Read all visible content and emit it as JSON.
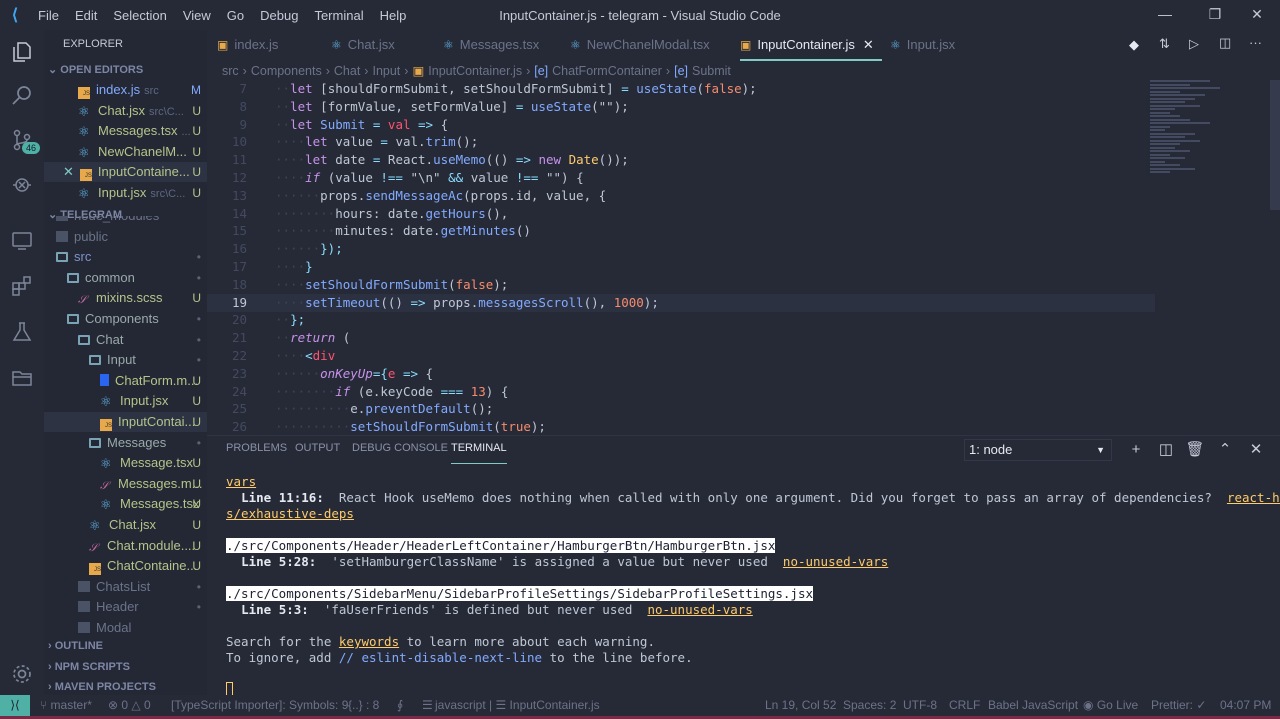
{
  "titlebar": {
    "menu": [
      "File",
      "Edit",
      "Selection",
      "View",
      "Go",
      "Debug",
      "Terminal",
      "Help"
    ],
    "title": "InputContainer.js - telegram - Visual Studio Code"
  },
  "activity": {
    "scm_badge": "46"
  },
  "sidebar": {
    "explorer_label": "EXPLORER",
    "open_editors_label": "OPEN EDITORS",
    "project_label": "TELEGRAM",
    "open_editors": [
      {
        "name": "index.js",
        "sub": "src",
        "status": "M",
        "icon": "js"
      },
      {
        "name": "Chat.jsx",
        "sub": "src\\C...",
        "status": "U",
        "icon": "react"
      },
      {
        "name": "Messages.tsx",
        "sub": "...",
        "status": "U",
        "icon": "react"
      },
      {
        "name": "NewChanelM...",
        "sub": "",
        "status": "U",
        "icon": "react"
      },
      {
        "name": "InputContaine...",
        "sub": "",
        "status": "U",
        "icon": "js",
        "active": true
      },
      {
        "name": "Input.jsx",
        "sub": "src\\C...",
        "status": "U",
        "icon": "react"
      }
    ],
    "tree": [
      {
        "name": "node_modules",
        "level": 0,
        "icon": "folderc",
        "status": ""
      },
      {
        "name": "public",
        "level": 0,
        "icon": "folderc",
        "status": ""
      },
      {
        "name": "src",
        "level": 0,
        "icon": "folder",
        "status": "•"
      },
      {
        "name": "common",
        "level": 1,
        "icon": "folder",
        "status": "•"
      },
      {
        "name": "mixins.scss",
        "level": 2,
        "icon": "sass",
        "status": "U"
      },
      {
        "name": "Components",
        "level": 1,
        "icon": "folder",
        "status": "•"
      },
      {
        "name": "Chat",
        "level": 2,
        "icon": "folder",
        "status": "•"
      },
      {
        "name": "Input",
        "level": 3,
        "icon": "folder",
        "status": "•"
      },
      {
        "name": "ChatForm.m...",
        "level": 4,
        "icon": "css",
        "status": "U"
      },
      {
        "name": "Input.jsx",
        "level": 4,
        "icon": "react",
        "status": "U"
      },
      {
        "name": "InputContai...",
        "level": 4,
        "icon": "js",
        "status": "U",
        "selected": true
      },
      {
        "name": "Messages",
        "level": 3,
        "icon": "folder",
        "status": "•"
      },
      {
        "name": "Message.tsx",
        "level": 4,
        "icon": "react",
        "status": "U"
      },
      {
        "name": "Messages.m...",
        "level": 4,
        "icon": "sass",
        "status": "U"
      },
      {
        "name": "Messages.tsx",
        "level": 4,
        "icon": "react",
        "status": "U"
      },
      {
        "name": "Chat.jsx",
        "level": 3,
        "icon": "react",
        "status": "U"
      },
      {
        "name": "Chat.module....",
        "level": 3,
        "icon": "sass",
        "status": "U"
      },
      {
        "name": "ChatContaine...",
        "level": 3,
        "icon": "js",
        "status": "U"
      },
      {
        "name": "ChatsList",
        "level": 2,
        "icon": "folderc",
        "status": "•"
      },
      {
        "name": "Header",
        "level": 2,
        "icon": "folderc",
        "status": "•"
      },
      {
        "name": "Modal",
        "level": 2,
        "icon": "folderc",
        "status": ""
      }
    ],
    "bottom_sections": [
      "OUTLINE",
      "NPM SCRIPTS",
      "MAVEN PROJECTS"
    ]
  },
  "tabs": [
    {
      "label": "index.js",
      "icon": "js"
    },
    {
      "label": "Chat.jsx",
      "icon": "react"
    },
    {
      "label": "Messages.tsx",
      "icon": "react"
    },
    {
      "label": "NewChanelModal.tsx",
      "icon": "react"
    },
    {
      "label": "InputContainer.js",
      "icon": "js",
      "active": true
    },
    {
      "label": "Input.jsx",
      "icon": "react"
    }
  ],
  "breadcrumbs": [
    "src",
    "Components",
    "Chat",
    "Input",
    "InputContainer.js",
    "ChatFormContainer",
    "Submit"
  ],
  "editor": {
    "current_line": 19,
    "lines": [
      {
        "n": "7",
        "t": [
          [
            "g",
            "··"
          ],
          [
            "k",
            "let "
          ],
          [
            "t",
            "[shouldFormSubmit, setShouldFormSubmit] "
          ],
          [
            "o",
            "= "
          ],
          [
            "f",
            "useState"
          ],
          [
            "t",
            "("
          ],
          [
            "n",
            "false"
          ],
          [
            "t",
            ");"
          ]
        ]
      },
      {
        "n": "8",
        "t": [
          [
            "g",
            "··"
          ],
          [
            "k",
            "let "
          ],
          [
            "t",
            "[formValue, setFormValue] "
          ],
          [
            "o",
            "= "
          ],
          [
            "f",
            "useState"
          ],
          [
            "t",
            "(\"\");"
          ]
        ]
      },
      {
        "n": "9",
        "t": [
          [
            "g",
            "··"
          ],
          [
            "k",
            "let "
          ],
          [
            "f",
            "Submit "
          ],
          [
            "o",
            "= "
          ],
          [
            "r",
            "val "
          ],
          [
            "o",
            "=> "
          ],
          [
            "t",
            "{"
          ]
        ]
      },
      {
        "n": "10",
        "t": [
          [
            "g",
            "····"
          ],
          [
            "k",
            "let "
          ],
          [
            "t",
            "value "
          ],
          [
            "o",
            "= "
          ],
          [
            "t",
            "val."
          ],
          [
            "f",
            "trim"
          ],
          [
            "t",
            "();"
          ]
        ]
      },
      {
        "n": "11",
        "t": [
          [
            "g",
            "····"
          ],
          [
            "k",
            "let "
          ],
          [
            "t",
            "date "
          ],
          [
            "o",
            "= "
          ],
          [
            "t",
            "React."
          ],
          [
            "f",
            "useMemo"
          ],
          [
            "t",
            "(() "
          ],
          [
            "o",
            "=> "
          ],
          [
            "k",
            "new "
          ],
          [
            "y",
            "Date"
          ],
          [
            "t",
            "());"
          ]
        ]
      },
      {
        "n": "12",
        "t": [
          [
            "g",
            "····"
          ],
          [
            "i",
            "if "
          ],
          [
            "t",
            "(value "
          ],
          [
            "o",
            "!== "
          ],
          [
            "t",
            "\"\\n\" "
          ],
          [
            "o",
            "&& "
          ],
          [
            "t",
            "value "
          ],
          [
            "o",
            "!== "
          ],
          [
            "t",
            "\"\") {"
          ]
        ]
      },
      {
        "n": "13",
        "t": [
          [
            "g",
            "······"
          ],
          [
            "t",
            "props."
          ],
          [
            "f",
            "sendMessageAc"
          ],
          [
            "t",
            "(props.id, value, {"
          ]
        ]
      },
      {
        "n": "14",
        "t": [
          [
            "g",
            "········"
          ],
          [
            "t",
            "hours: date."
          ],
          [
            "f",
            "getHours"
          ],
          [
            "t",
            "(),"
          ]
        ]
      },
      {
        "n": "15",
        "t": [
          [
            "g",
            "········"
          ],
          [
            "t",
            "minutes: date."
          ],
          [
            "f",
            "getMinutes"
          ],
          [
            "t",
            "()"
          ]
        ]
      },
      {
        "n": "16",
        "t": [
          [
            "g",
            "······"
          ],
          [
            "o",
            "});"
          ]
        ]
      },
      {
        "n": "17",
        "t": [
          [
            "g",
            "····"
          ],
          [
            "o",
            "}"
          ]
        ]
      },
      {
        "n": "18",
        "t": [
          [
            "g",
            "····"
          ],
          [
            "f",
            "setShouldFormSubmit"
          ],
          [
            "t",
            "("
          ],
          [
            "n",
            "false"
          ],
          [
            "t",
            ");"
          ]
        ]
      },
      {
        "n": "19",
        "t": [
          [
            "g",
            "····"
          ],
          [
            "f",
            "setTimeout"
          ],
          [
            "t",
            "(() "
          ],
          [
            "o",
            "=> "
          ],
          [
            "t",
            "props."
          ],
          [
            "f",
            "messagesScroll"
          ],
          [
            "t",
            "(), "
          ],
          [
            "n",
            "1000"
          ],
          [
            "t",
            ");"
          ]
        ]
      },
      {
        "n": "20",
        "t": [
          [
            "g",
            "··"
          ],
          [
            "o",
            "};"
          ]
        ]
      },
      {
        "n": "21",
        "t": [
          [
            "g",
            "··"
          ],
          [
            "i",
            "return "
          ],
          [
            "t",
            "("
          ]
        ]
      },
      {
        "n": "22",
        "t": [
          [
            "g",
            "····"
          ],
          [
            "o",
            "<"
          ],
          [
            "r",
            "div"
          ]
        ]
      },
      {
        "n": "23",
        "t": [
          [
            "g",
            "······"
          ],
          [
            "i",
            "onKeyUp"
          ],
          [
            "o",
            "={"
          ],
          [
            "r",
            "e "
          ],
          [
            "o",
            "=> "
          ],
          [
            "t",
            "{"
          ]
        ]
      },
      {
        "n": "24",
        "t": [
          [
            "g",
            "········"
          ],
          [
            "i",
            "if "
          ],
          [
            "t",
            "(e.keyCode "
          ],
          [
            "o",
            "=== "
          ],
          [
            "n",
            "13"
          ],
          [
            "t",
            ") {"
          ]
        ]
      },
      {
        "n": "25",
        "t": [
          [
            "g",
            "··········"
          ],
          [
            "t",
            "e."
          ],
          [
            "f",
            "preventDefault"
          ],
          [
            "t",
            "();"
          ]
        ]
      },
      {
        "n": "26",
        "t": [
          [
            "g",
            "··········"
          ],
          [
            "f",
            "setShouldFormSubmit"
          ],
          [
            "t",
            "("
          ],
          [
            "n",
            "true"
          ],
          [
            "t",
            ");"
          ]
        ]
      }
    ]
  },
  "panel": {
    "tabs": [
      "PROBLEMS",
      "OUTPUT",
      "DEBUG CONSOLE",
      "TERMINAL"
    ],
    "active_tab": "TERMINAL",
    "terminal_select": "1: node",
    "terminal": [
      [
        [
          "u",
          "vars"
        ]
      ],
      [
        [
          "t",
          "  "
        ],
        [
          "b",
          "Line 11:16:"
        ],
        [
          "t",
          "  React Hook useMemo does nothing when called with only one argument. Did you forget to pass an array of dependencies?  "
        ],
        [
          "u",
          "react-hook"
        ]
      ],
      [
        [
          "u",
          "s/exhaustive-deps"
        ]
      ],
      [
        [
          "t",
          ""
        ]
      ],
      [
        [
          "hl",
          "./src/Components/Header/HeaderLeftContainer/HamburgerBtn/HamburgerBtn.jsx"
        ]
      ],
      [
        [
          "t",
          "  "
        ],
        [
          "b",
          "Line 5:28:"
        ],
        [
          "t",
          "  'setHamburgerClassName' is assigned a value but never used  "
        ],
        [
          "u",
          "no-unused-vars"
        ]
      ],
      [
        [
          "t",
          ""
        ]
      ],
      [
        [
          "hl",
          "./src/Components/SidebarMenu/SidebarProfileSettings/SidebarProfileSettings.jsx"
        ]
      ],
      [
        [
          "t",
          "  "
        ],
        [
          "b",
          "Line 5:3:"
        ],
        [
          "t",
          "  'faUserFriends' is defined but never used  "
        ],
        [
          "u",
          "no-unused-vars"
        ]
      ],
      [
        [
          "t",
          ""
        ]
      ],
      [
        [
          "t",
          "Search for the "
        ],
        [
          "u",
          "keywords"
        ],
        [
          "t",
          " to learn more about each warning."
        ]
      ],
      [
        [
          "t",
          "To ignore, add "
        ],
        [
          "c",
          "// eslint-disable-next-line"
        ],
        [
          "t",
          " to the line before."
        ]
      ]
    ]
  },
  "status": {
    "branch": "master*",
    "errors": "0",
    "warnings": "0",
    "ts_importer": "[TypeScript Importer]: Symbols: 9",
    "brackets": "{..} : 8",
    "lang_info": "javascript | ☰ InputContainer.js",
    "position": "Ln 19, Col 52",
    "spaces": "Spaces: 2",
    "encoding": "UTF-8",
    "eol": "CRLF",
    "language": "Babel JavaScript",
    "golive": "Go Live",
    "prettier": "Prettier: ✓",
    "time": "04:07 PM"
  }
}
